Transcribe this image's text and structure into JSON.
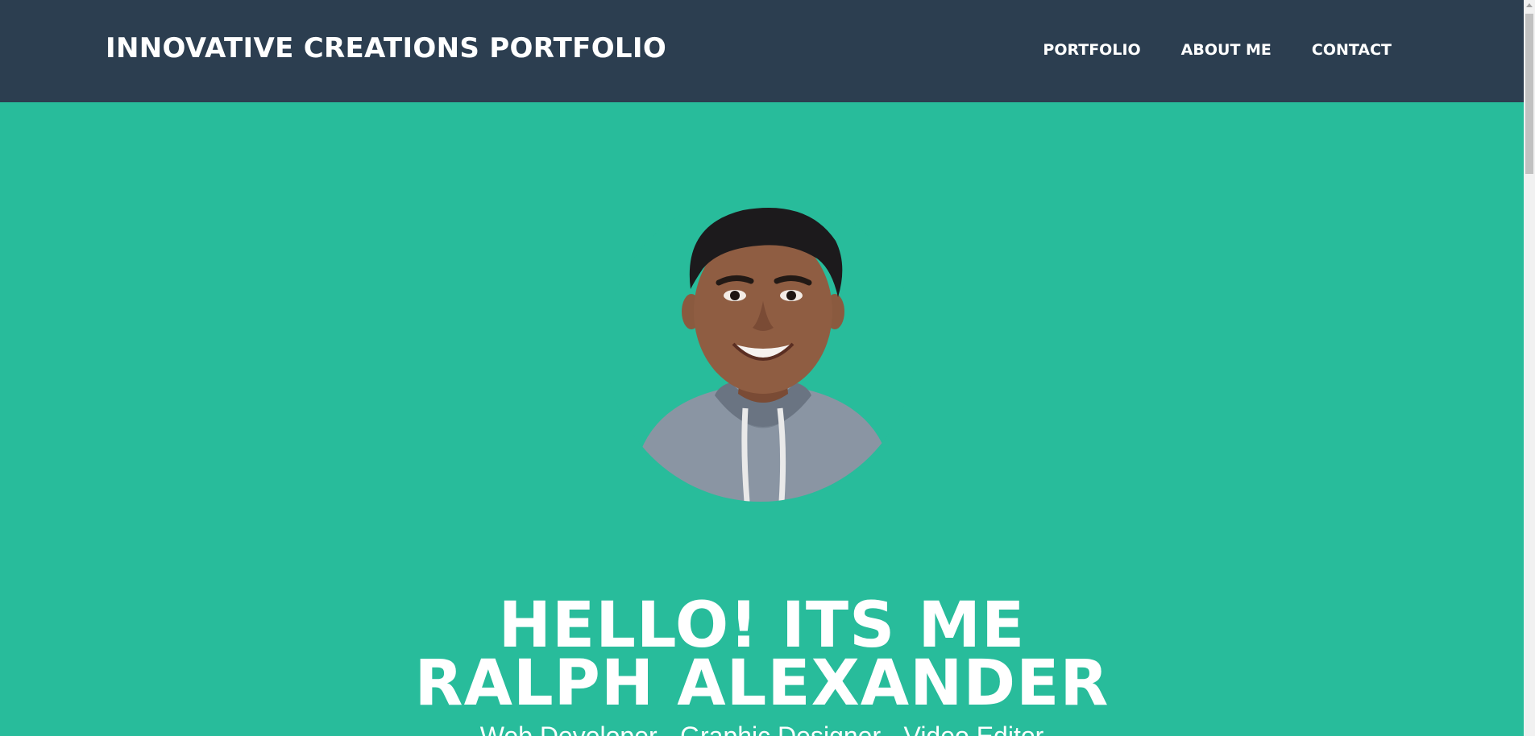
{
  "navbar": {
    "brand": "INNOVATIVE CREATIONS PORTFOLIO",
    "links": [
      "PORTFOLIO",
      "ABOUT ME",
      "CONTACT"
    ]
  },
  "hero": {
    "heading_line1": "HELLO! ITS ME",
    "heading_line2": "RALPH ALEXANDER",
    "subtitle": "Web Developer - Graphic Designer - Video Editor"
  },
  "colors": {
    "navbar_bg": "#2c3e50",
    "hero_bg": "#28bc9b",
    "text": "#ffffff"
  }
}
